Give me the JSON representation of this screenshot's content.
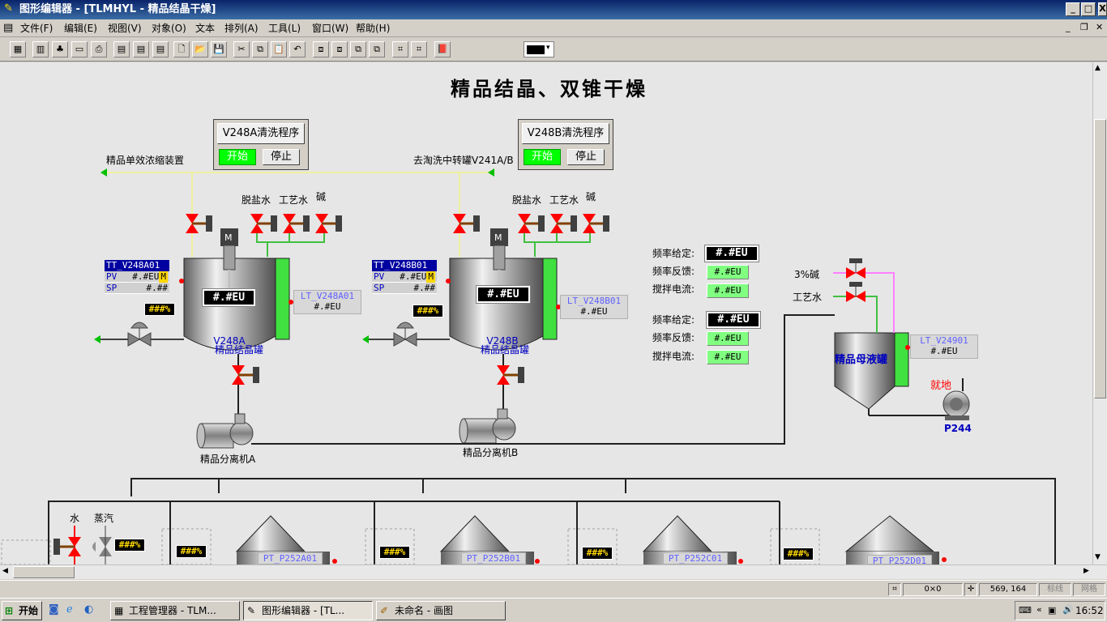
{
  "window": {
    "title": "图形编辑器 - [TLMHYL - 精品结晶干燥]",
    "minimize": "_",
    "maximize": "□",
    "close": "X"
  },
  "menu": {
    "items": [
      "文件(F)",
      "编辑(E)",
      "视图(V)",
      "对象(O)",
      "文本",
      "排列(A)",
      "工具(L)",
      "窗口(W)",
      "帮助(H)"
    ]
  },
  "diagram": {
    "title": "精品结晶、双锥干燥",
    "prog_a": {
      "title": "V248A清洗程序",
      "start": "开始",
      "stop": "停止"
    },
    "prog_b": {
      "title": "V248B清洗程序",
      "start": "开始",
      "stop": "停止"
    },
    "pipe_left_label": "精品单效浓缩装置",
    "pipe_right_label": "去淘洗中转罐V241A/B",
    "valves_a": {
      "desalted": "脱盐水",
      "process": "工艺水",
      "alkali": "碱"
    },
    "valves_b": {
      "desalted": "脱盐水",
      "process": "工艺水",
      "alkali": "碱"
    },
    "tank_a": {
      "display": "#.#EU",
      "code": "V248A",
      "name": "精品结晶罐",
      "motor": "M"
    },
    "tank_b": {
      "display": "#.#EU",
      "code": "V248B",
      "name": "精品结晶罐",
      "motor": "M"
    },
    "tt_a": {
      "tag": "TT_V248A01",
      "mode": "M",
      "pv_label": "PV",
      "pv": "#.#EU",
      "sp_label": "SP",
      "sp": "#.##"
    },
    "tt_b": {
      "tag": "TT_V248B01",
      "mode": "M",
      "pv_label": "PV",
      "pv": "#.#EU",
      "sp_label": "SP",
      "sp": "#.##"
    },
    "lt_a": {
      "tag": "LT_V248A01",
      "value": "#.#EU"
    },
    "lt_b": {
      "tag": "LT_V248B01",
      "value": "#.#EU"
    },
    "pct_a": "###%",
    "pct_b": "###%",
    "freq1": {
      "set_label": "频率给定:",
      "set": "#.#EU",
      "fb_label": "频率反馈:",
      "fb": "#.#EU",
      "cur_label": "搅拌电流:",
      "cur": "#.#EU"
    },
    "freq2": {
      "set_label": "频率给定:",
      "set": "#.#EU",
      "fb_label": "频率反馈:",
      "fb": "#.#EU",
      "cur_label": "搅拌电流:",
      "cur": "#.#EU"
    },
    "centrifuge_a": "精品分离机A",
    "centrifuge_b": "精品分离机B",
    "mother_tank": {
      "name": "精品母液罐",
      "alkali": "3%碱",
      "process": "工艺水",
      "lt_tag": "LT_V24901",
      "lt_value": "#.#EU"
    },
    "pump": {
      "name": "P244",
      "status": "就地"
    },
    "dryer_water": "水",
    "dryer_steam": "蒸汽",
    "dryers": [
      {
        "pct": "###%",
        "tag": "PT_P252A01"
      },
      {
        "pct": "###%",
        "tag": "PT_P252B01"
      },
      {
        "pct": "###%",
        "tag": "PT_P252C01"
      },
      {
        "pct": "###%",
        "tag": "PT_P252D01"
      }
    ],
    "dryer_valve_pct": "###%"
  },
  "status": {
    "size": "0×0",
    "coords": "569, 164",
    "ruler": "标线",
    "grid": "网格"
  },
  "taskbar": {
    "start": "开始",
    "tasks": [
      "工程管理器 - TLM...",
      "图形编辑器 - [TL...",
      "未命名 - 画图"
    ],
    "clock": "16:52"
  },
  "colors": {
    "title_bar": "#0a246a",
    "canvas": "#e6e6e6",
    "run_green": "#00ff00",
    "level_green": "#40e040",
    "valve_red": "#ff0000",
    "pipe_yellow": "#f0f0a0",
    "pipe_pink": "#ff80ff"
  }
}
